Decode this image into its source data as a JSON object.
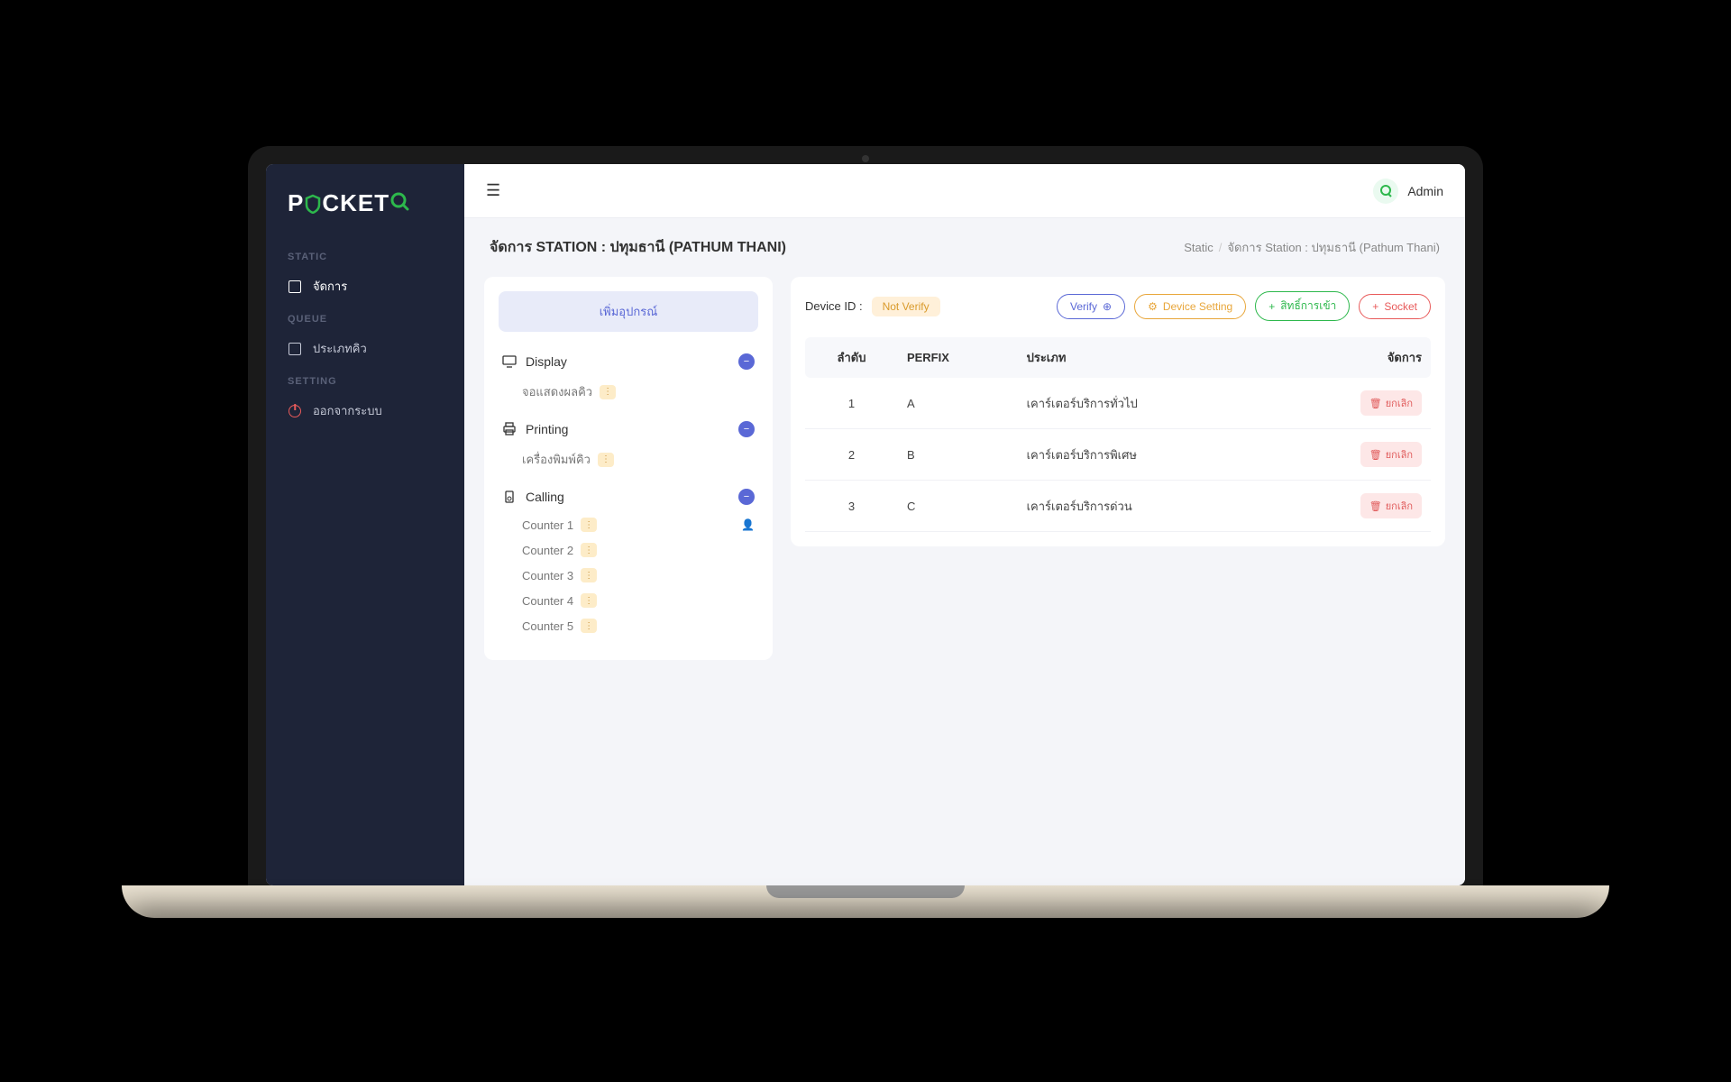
{
  "logo": {
    "part1": "P",
    "part2": "CKET"
  },
  "sidebar": {
    "sections": [
      {
        "label": "STATIC",
        "items": [
          {
            "label": "จัดการ"
          }
        ]
      },
      {
        "label": "QUEUE",
        "items": [
          {
            "label": "ประเภทคิว"
          }
        ]
      },
      {
        "label": "SETTING",
        "items": [
          {
            "label": "ออกจากระบบ"
          }
        ]
      }
    ]
  },
  "topbar": {
    "user": "Admin"
  },
  "page": {
    "title": "จัดการ STATION : ปทุมธานี (PATHUM THANI)",
    "crumb1": "Static",
    "crumb2": "จัดการ Station : ปทุมธานี (Pathum Thani)"
  },
  "left_panel": {
    "add_label": "เพิ่มอุปกรณ์",
    "groups": [
      {
        "name": "Display",
        "children": [
          {
            "label": "จอแสดงผลคิว"
          }
        ]
      },
      {
        "name": "Printing",
        "children": [
          {
            "label": "เครื่องพิมพ์คิว"
          }
        ]
      },
      {
        "name": "Calling",
        "children": [
          {
            "label": "Counter 1",
            "active": true
          },
          {
            "label": "Counter 2"
          },
          {
            "label": "Counter 3"
          },
          {
            "label": "Counter 4"
          },
          {
            "label": "Counter 5"
          }
        ]
      }
    ]
  },
  "right_panel": {
    "device_id_label": "Device ID :",
    "not_verify": "Not Verify",
    "buttons": {
      "verify": "Verify",
      "device_setting": "Device Setting",
      "access": "สิทธิ์การเข้า",
      "socket": "Socket"
    },
    "table": {
      "headers": [
        "ลำดับ",
        "PERFIX",
        "ประเภท",
        "จัดการ"
      ],
      "cancel_label": "ยกเลิก",
      "rows": [
        {
          "no": "1",
          "prefix": "A",
          "type": "เคาร์เตอร์บริการทั่วไป"
        },
        {
          "no": "2",
          "prefix": "B",
          "type": "เคาร์เตอร์บริการพิเศษ"
        },
        {
          "no": "3",
          "prefix": "C",
          "type": "เคาร์เตอร์บริการด่วน"
        }
      ]
    }
  }
}
